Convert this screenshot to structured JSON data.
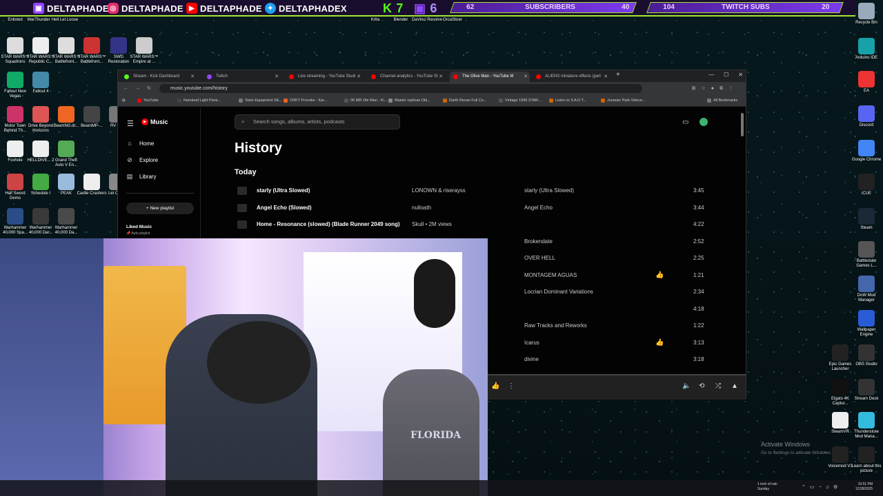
{
  "banner": {
    "handles": [
      "DELTAPHADE",
      "DELTAPHADE",
      "DELTAPHADE",
      "DELTAPHADEX"
    ],
    "counts": {
      "kick": "7",
      "twitch": "6"
    },
    "subscribers": {
      "left": "62",
      "label": "SUBSCRIBERS",
      "right": "40"
    },
    "twitch_subs": {
      "left": "104",
      "label": "TWITCH SUBS",
      "right": "20"
    },
    "colors": {
      "accent": "#a3e635",
      "purple": "#7c3aed"
    }
  },
  "desktop_icons": {
    "top_row": [
      "Enlisted",
      "WarThunder",
      "Hell Let Loose",
      "Krita",
      "Blender",
      "DaVinci Resolve",
      "OrcaSlicer",
      "Recycle Bin"
    ],
    "left": [
      "STAR WARS™ Squadrons",
      "STAR WARS™ Republic C...",
      "STAR WARS™ Battlefront...",
      "STAR WARS™ Battlefront...",
      "SWG Restoration",
      "STAR WARS™ Empire at ...",
      "Fallout New Vegas",
      "Fallout 4",
      "Motor Town Behind Th...",
      "Drive Beyond Horizons",
      "BeamNG.dr...",
      "BeamMP-...",
      "RV The",
      "Foxhole",
      "HELLDIVE... 2",
      "Grand Theft Auto V En...",
      "Half Sword Demo",
      "Schedule I",
      "PEAK",
      "Castle Crashers",
      "Let Comp",
      "Warhammer 40,000 Spa...",
      "Warhammer 40,000 Dar...",
      "Warhammer 40,000 Da..."
    ],
    "right": [
      "Arduino IDE",
      "EA",
      "Discord",
      "Google Chrome",
      "iCUE",
      "Steam",
      "Battlestate Games L...",
      "DoW Mod Manager",
      "Wallpaper Engine",
      "Epic Games Launcher",
      "OBS Studio",
      "Elgato 4K Captur...",
      "Stream Deck",
      "SteamVR",
      "Thunderstore Mod Mana...",
      "Voicemod V3",
      "Learn about this picture"
    ]
  },
  "browser": {
    "tabs": [
      "Stream - Kick Dashboard",
      "Twitch",
      "Live streaming - YouTube Studi",
      "Channel analytics - YouTube St",
      "The Olive Man - YouTube M",
      "ALIENS miniature effects (part"
    ],
    "url": "music.youtube.com/history",
    "bookmarks": [
      "YouTube",
      "Nanoleaf Light Pane...",
      "Stark Equipment SE...",
      "CRKT Provoke - Kar...",
      "06 MR Obi Wan - Ki...",
      "Master replicas Obi...",
      "Darth Revan Full Co...",
      "Vintage 1999 STAR...",
      "Listen to S A D T...",
      "Jurassic Park Veloce...",
      "All Bookmarks"
    ]
  },
  "ytm": {
    "logo": "Music",
    "nav": [
      "Home",
      "Explore",
      "Library"
    ],
    "new_playlist": "New playlist",
    "liked": "Liked Music",
    "liked_sub": "Auto playlist",
    "search_placeholder": "Search songs, albums, artists, podcasts",
    "title": "History",
    "section": "Today",
    "rows": [
      {
        "title": "starly (Ultra Slowed)",
        "artist": "LONOWN & riserayss",
        "album": "starly (Ultra Slowed)",
        "liked": "",
        "dur": "3:45"
      },
      {
        "title": "Angel Echo (Slowed)",
        "artist": "nulloath",
        "album": "Angel Echo",
        "liked": "",
        "dur": "3:44"
      },
      {
        "title": "Home - Resonance (slowed) (Blade Runner 2049 song)",
        "artist": "Skull • 2M views",
        "album": "",
        "liked": "",
        "dur": "4:22"
      },
      {
        "title": "",
        "artist": "",
        "album": "Brokendate",
        "liked": "",
        "dur": "2:52"
      },
      {
        "title": "",
        "artist": "",
        "album": "OVER HELL",
        "liked": "",
        "dur": "2:25"
      },
      {
        "title": "",
        "artist": "",
        "album": "MONTAGEM AGUAS",
        "liked": "👍",
        "dur": "1:21"
      },
      {
        "title": "",
        "artist": "",
        "album": "Locrian Dominant Variations",
        "liked": "",
        "dur": "2:34"
      },
      {
        "title": "",
        "artist": "",
        "album": "",
        "liked": "",
        "dur": "4:18"
      },
      {
        "title": "",
        "artist": "",
        "album": "Raw Tracks and Reworks",
        "liked": "",
        "dur": "1:22"
      },
      {
        "title": "",
        "artist": "",
        "album": "Icarus",
        "liked": "👍",
        "dur": "3:13"
      },
      {
        "title": "",
        "artist": "",
        "album": "divine",
        "liked": "",
        "dur": "3:18"
      }
    ],
    "progress": 0.42
  },
  "webcam": {
    "shirt_text": "FLORIDA"
  },
  "system": {
    "activate_title": "Activate Windows",
    "activate_sub": "Go to Settings to activate Windows.",
    "weather_line1": "1 inch of rain",
    "weather_line2": "Sunday",
    "time": "10:51 PM",
    "date": "12/28/2025"
  }
}
